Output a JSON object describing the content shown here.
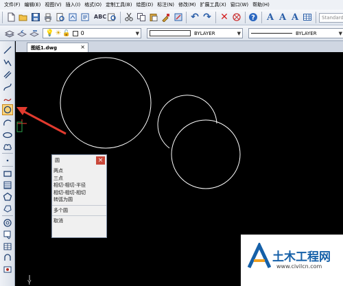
{
  "menubar": {
    "items": [
      "文件(F)",
      "编辑(E)",
      "视图(V)",
      "插入(I)",
      "格式(O)",
      "定制工具(B)",
      "绘图(D)",
      "标注(N)",
      "修改(M)",
      "扩展工具(X)",
      "窗口(W)",
      "帮助(H)"
    ]
  },
  "toolbar": {
    "style_placeholder": "Standard"
  },
  "layer": {
    "current": "0",
    "color": "BYLAYER",
    "linetype": "BYLAYER"
  },
  "document": {
    "tab_title": "图纸1.dwg",
    "close_glyph": "×"
  },
  "circle_menu": {
    "title": "圆",
    "close_glyph": "×",
    "options": [
      "两点",
      "三点",
      "相切-相切-半径",
      "相切-相切-相切",
      "转弧为圆"
    ],
    "options2": [
      "多个圆"
    ],
    "cancel": "取消"
  },
  "ucs": {
    "y_label": "Y"
  },
  "watermark": {
    "text": "土木工程网",
    "url": "www.civilcn.com"
  },
  "colors": {
    "canvas": "#000000",
    "circle_stroke": "#ffffff",
    "arrow": "#e23a2e",
    "popup_close": "#c9483a",
    "brand_blue": "#1560a8"
  },
  "icons": {
    "left_toolbar": [
      "line-icon",
      "polyline-icon",
      "multiline-icon",
      "spline-icon",
      "freehand-icon",
      "circle-icon",
      "arc-icon",
      "ellipse-icon",
      "revcloud-icon",
      "point-icon",
      "rectangle-icon",
      "hatch-icon",
      "polygon-icon",
      "region-icon",
      "donut-icon",
      "block-icon",
      "table-icon",
      "text-icon",
      "wipeout-icon"
    ]
  }
}
